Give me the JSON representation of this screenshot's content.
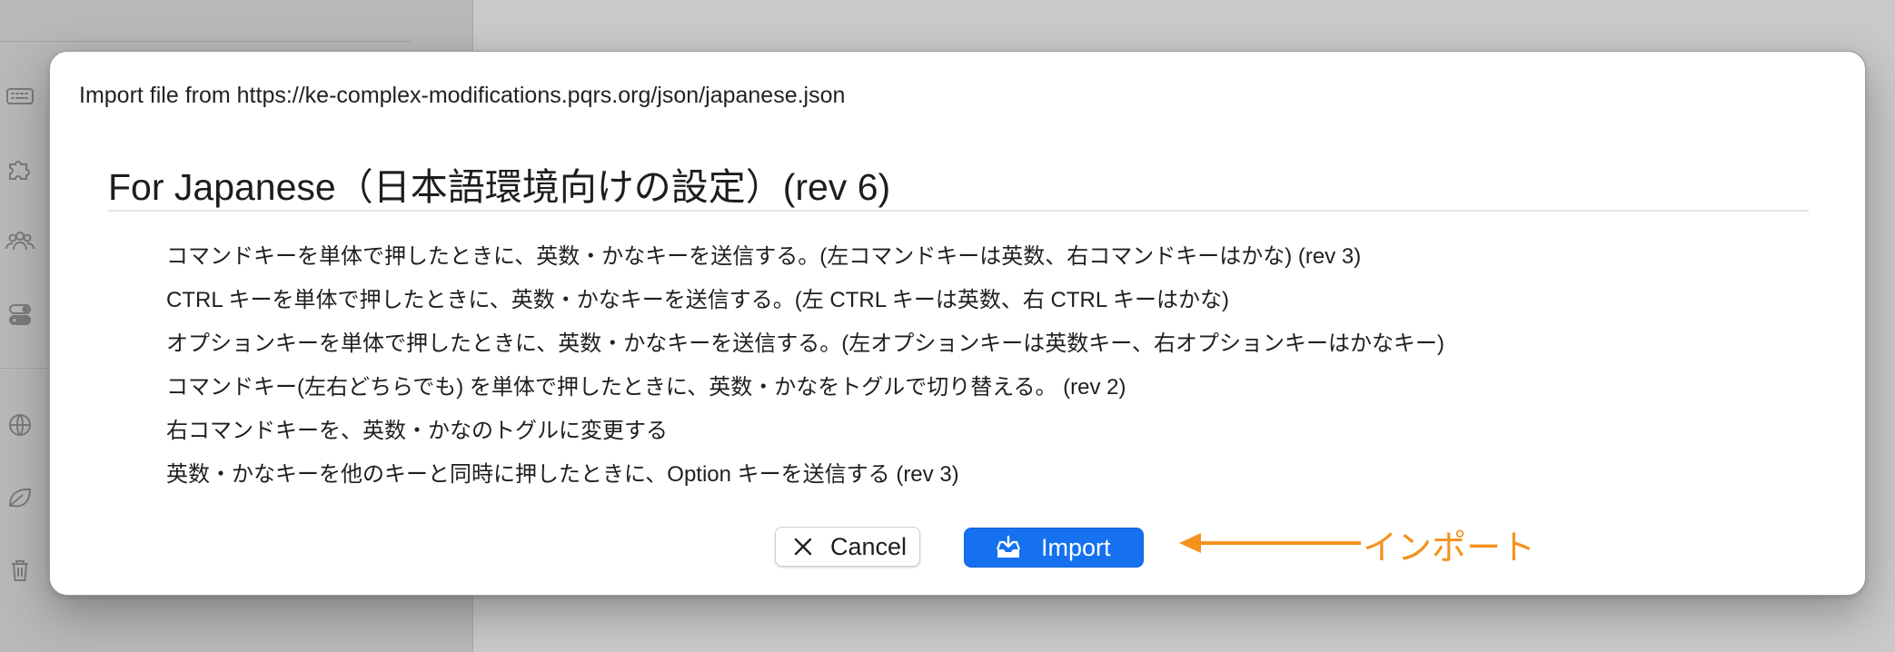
{
  "dialog": {
    "source_line": "Import file from https://ke-complex-modifications.pqrs.org/json/japanese.json",
    "title": "For Japanese（日本語環境向けの設定）(rev 6)",
    "rules": [
      "コマンドキーを単体で押したときに、英数・かなキーを送信する。(左コマンドキーは英数、右コマンドキーはかな) (rev 3)",
      "CTRL キーを単体で押したときに、英数・かなキーを送信する。(左 CTRL キーは英数、右 CTRL キーはかな)",
      "オプションキーを単体で押したときに、英数・かなキーを送信する。(左オプションキーは英数キー、右オプションキーはかなキー)",
      "コマンドキー(左右どちらでも) を単体で押したときに、英数・かなをトグルで切り替える。 (rev 2)",
      "右コマンドキーを、英数・かなのトグルに変更する",
      "英数・かなキーを他のキーと同時に押したときに、Option キーを送信する (rev 3)"
    ],
    "cancel_label": "Cancel",
    "import_label": "Import"
  },
  "annotation": {
    "label": "インポート",
    "color": "#f5921e"
  },
  "sidebar": {
    "icons": [
      "keyboard-icon",
      "puzzle-icon",
      "users-icon",
      "toggle-icon",
      "globe-icon",
      "leaf-icon",
      "trash-icon"
    ]
  },
  "colors": {
    "accent": "#1671f0",
    "annotation": "#f5921e"
  }
}
